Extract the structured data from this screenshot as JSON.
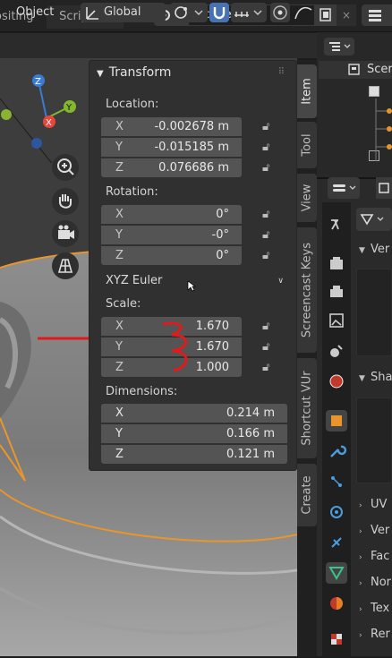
{
  "header": {
    "tabs": [
      "ositing",
      "Scripting"
    ],
    "add_tab": "+",
    "scene_label": "Scene",
    "close_symbol": "×"
  },
  "viewport_header": {
    "object_menu": "Object",
    "orientation": "Global"
  },
  "transform_panel": {
    "title": "Transform",
    "location_label": "Location:",
    "location": [
      {
        "axis": "X",
        "value": "-0.002678 m"
      },
      {
        "axis": "Y",
        "value": "-0.015185 m"
      },
      {
        "axis": "Z",
        "value": "0.076686 m"
      }
    ],
    "rotation_label": "Rotation:",
    "rotation": [
      {
        "axis": "X",
        "value": "0°"
      },
      {
        "axis": "Y",
        "value": "-0°"
      },
      {
        "axis": "Z",
        "value": "0°"
      }
    ],
    "rotation_mode": "XYZ Euler",
    "scale_label": "Scale:",
    "scale": [
      {
        "axis": "X",
        "value": "1.670"
      },
      {
        "axis": "Y",
        "value": "1.670"
      },
      {
        "axis": "Z",
        "value": "1.000"
      }
    ],
    "dimensions_label": "Dimensions:",
    "dimensions": [
      {
        "axis": "X",
        "value": "0.214 m"
      },
      {
        "axis": "Y",
        "value": "0.166 m"
      },
      {
        "axis": "Z",
        "value": "0.121 m"
      }
    ]
  },
  "gizmo_labels": {
    "z": "Z",
    "y": "Y",
    "x": "X"
  },
  "sidebar_tabs": [
    "Item",
    "Tool",
    "View",
    "Screencast Keys",
    "Shortcut VUr",
    "Create"
  ],
  "outliner": {
    "title": "Scer"
  },
  "properties": {
    "sections": [
      "Ver",
      "Sha",
      "UV",
      "Ver",
      "Fac",
      "Nor",
      "Tex",
      "Rer"
    ]
  },
  "colors": {
    "accent": "#4772b3",
    "annotation_red": "#e01b1b",
    "object_outline": "#e8962c",
    "axis_x": "#e8463c",
    "axis_y": "#83b82c",
    "axis_z": "#3a7bd5"
  }
}
